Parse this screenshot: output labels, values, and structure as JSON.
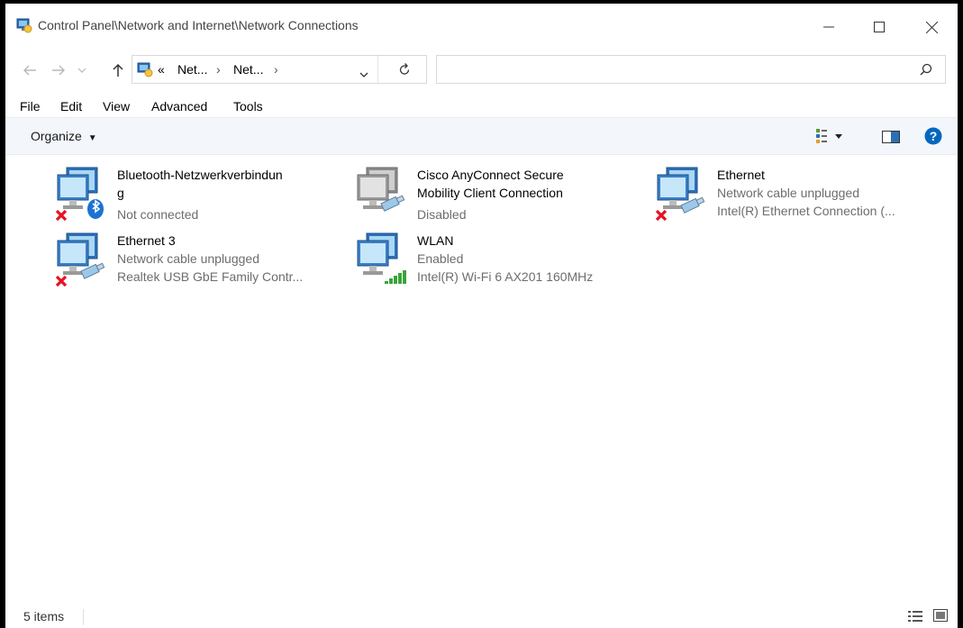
{
  "window": {
    "title": "Control Panel\\Network and Internet\\Network Connections"
  },
  "address": {
    "overflow": "«",
    "crumbs": [
      "Net...",
      "Net..."
    ],
    "search_placeholder": ""
  },
  "menu": [
    "File",
    "Edit",
    "View",
    "Advanced",
    "Tools"
  ],
  "toolbar": {
    "organize_label": "Organize"
  },
  "connections": [
    {
      "name": "Bluetooth-Netzwerkverbindun\ng",
      "status": "Not connected",
      "device": "",
      "icon": "bluetooth-network-icon",
      "error": true
    },
    {
      "name": "Cisco AnyConnect Secure\nMobility Client Connection",
      "status": "Disabled",
      "device": "",
      "icon": "vpn-network-icon",
      "error": false
    },
    {
      "name": "Ethernet",
      "status": "Network cable unplugged",
      "device": "Intel(R) Ethernet Connection (...",
      "icon": "ethernet-network-icon",
      "error": true
    },
    {
      "name": "Ethernet 3",
      "status": "Network cable unplugged",
      "device": "Realtek USB GbE Family Contr...",
      "icon": "ethernet-network-icon",
      "error": true
    },
    {
      "name": "WLAN",
      "status": "Enabled",
      "device": "Intel(R) Wi-Fi 6 AX201 160MHz",
      "icon": "wifi-network-icon",
      "error": false
    }
  ],
  "status": {
    "items_count": "5 items"
  },
  "colors": {
    "accent": "#0067c0",
    "cmdbar_bg": "#f3f6fa",
    "error": "#e81123",
    "signal": "#3aa53a"
  }
}
